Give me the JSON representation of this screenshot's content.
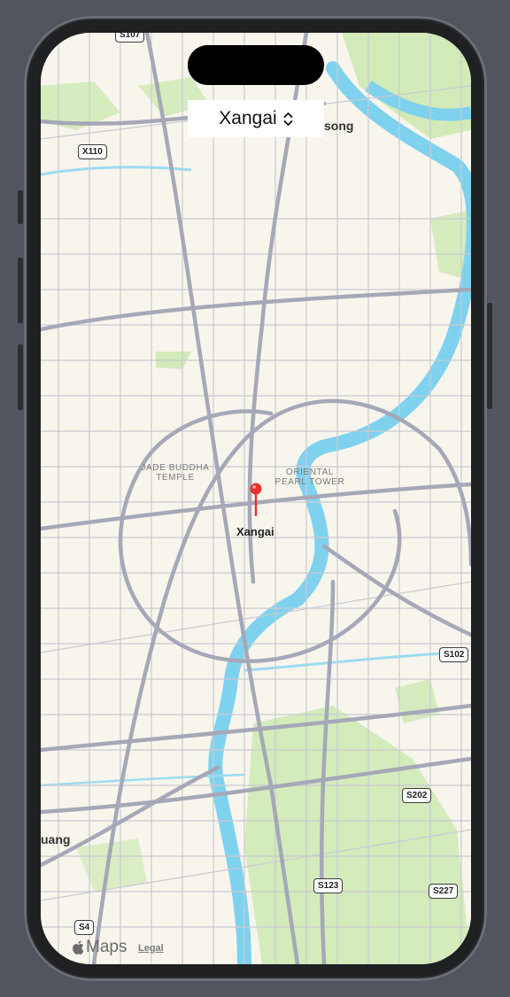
{
  "location_picker": {
    "selected": "Xangai",
    "icon": "chevron-up-down-icon"
  },
  "map": {
    "pin_label": "Xangai",
    "place_labels": {
      "jade_buddha": "JADE BUDDHA\nTEMPLE",
      "oriental_pearl": "ORIENTAL\nPEARL TOWER"
    },
    "partial_labels": {
      "top_right": "song",
      "left": "uang"
    },
    "road_shields": {
      "s107": "S107",
      "x110": "X110",
      "s102": "S102",
      "s202": "S202",
      "s123": "S123",
      "s227": "S227",
      "s4": "S4"
    },
    "colors": {
      "land": "#f8f5ec",
      "water": "#7fd2ee",
      "park": "#c5e6a8",
      "road": "#a9abb8",
      "pin": "#e5322d"
    }
  },
  "attribution": {
    "brand": "Maps",
    "legal": "Legal"
  }
}
